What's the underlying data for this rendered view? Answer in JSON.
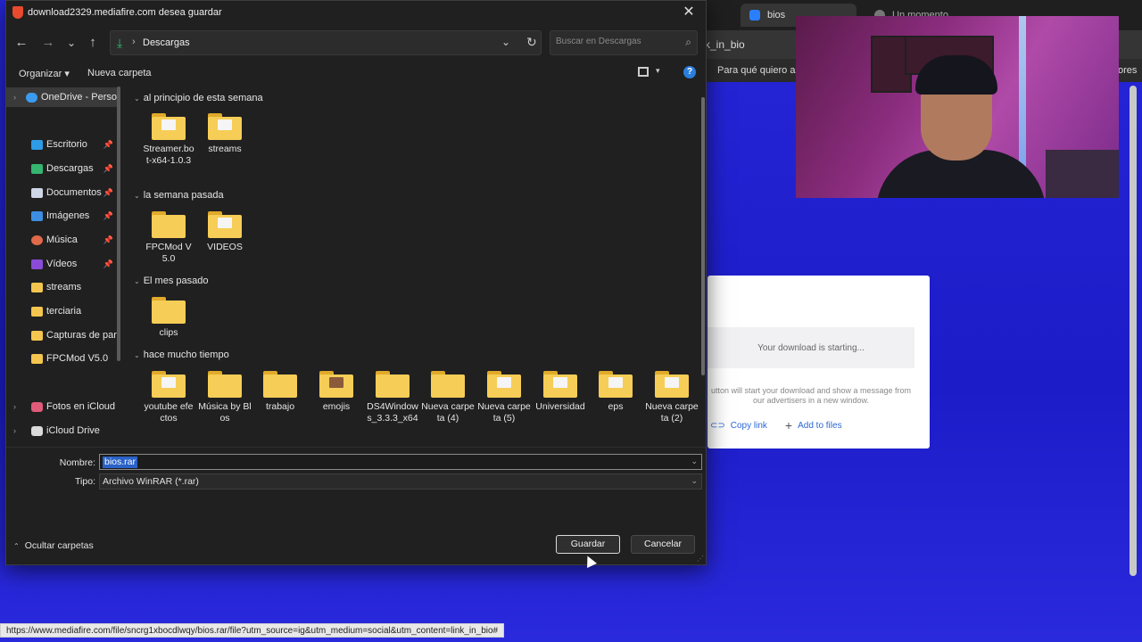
{
  "background_browser": {
    "tabs": [
      {
        "label": "bios"
      },
      {
        "label": "Un momento..."
      }
    ],
    "address_fragment": "k_in_bio",
    "bookmarks": [
      "Para qué quiero asp",
      "ores"
    ],
    "download_card": {
      "status": "Your download is starting...",
      "message_line1": "utton will start your download and show a message from",
      "message_line2": "our advertisers in a new window.",
      "copy_link": "Copy link",
      "add_to_files": "Add to files"
    },
    "status_url": "https://www.mediafire.com/file/sncrg1xbocdlwqy/bios.rar/file?utm_source=ig&utm_medium=social&utm_content=link_in_bio#"
  },
  "dialog": {
    "title": "download2329.mediafire.com desea guardar",
    "close_glyph": "✕",
    "nav": {
      "back": "←",
      "forward": "→",
      "recent": "⌄",
      "up": "↑"
    },
    "address": {
      "location": "Descargas",
      "chevron": "›",
      "dropdown": "⌄",
      "refresh": "↻"
    },
    "search": {
      "placeholder": "Buscar en Descargas",
      "icon": "⌕"
    },
    "command_bar": {
      "organize": "Organizar ▾",
      "new_folder": "Nueva carpeta",
      "help": "?"
    },
    "navigation_pane": [
      {
        "label": "OneDrive - Perso",
        "icon": "cloud",
        "expander": "›",
        "selected": true
      },
      {
        "label": "Escritorio",
        "icon": "blue",
        "pinned": true
      },
      {
        "label": "Descargas",
        "icon": "green",
        "pinned": true
      },
      {
        "label": "Documentos",
        "icon": "doc",
        "pinned": true
      },
      {
        "label": "Imágenes",
        "icon": "img",
        "pinned": true
      },
      {
        "label": "Música",
        "icon": "music",
        "pinned": true
      },
      {
        "label": "Vídeos",
        "icon": "video",
        "pinned": true
      },
      {
        "label": "streams",
        "icon": "folder"
      },
      {
        "label": "terciaria",
        "icon": "folder"
      },
      {
        "label": "Capturas de pan",
        "icon": "folder"
      },
      {
        "label": "FPCMod V5.0",
        "icon": "folder"
      },
      {
        "label": "Fotos en iCloud",
        "icon": "photos",
        "expander": "›"
      },
      {
        "label": "iCloud Drive",
        "icon": "icloud",
        "expander": "›"
      }
    ],
    "groups": [
      {
        "header": "al principio de esta semana",
        "items": [
          "Streamer.bot-x64-1.0.3",
          "streams"
        ]
      },
      {
        "header": "la semana pasada",
        "items": [
          "FPCMod V5.0",
          "VIDEOS"
        ]
      },
      {
        "header": "El mes pasado",
        "items": [
          "clips"
        ]
      },
      {
        "header": "hace mucho tiempo",
        "items": [
          "youtube efectos",
          "Música by Blos",
          "trabajo",
          "emojis",
          "DS4Windows_3.3.3_x64",
          "Nueva carpeta (4)",
          "Nueva carpeta (5)",
          "Universidad",
          "eps",
          "Nueva carpeta (2)"
        ]
      }
    ],
    "filename": {
      "label": "Nombre:",
      "value": "bios.rar"
    },
    "filetype": {
      "label": "Tipo:",
      "value": "Archivo WinRAR (*.rar)"
    },
    "hide_folders": "Ocultar carpetas",
    "save_button": "Guardar",
    "cancel_button": "Cancelar"
  }
}
